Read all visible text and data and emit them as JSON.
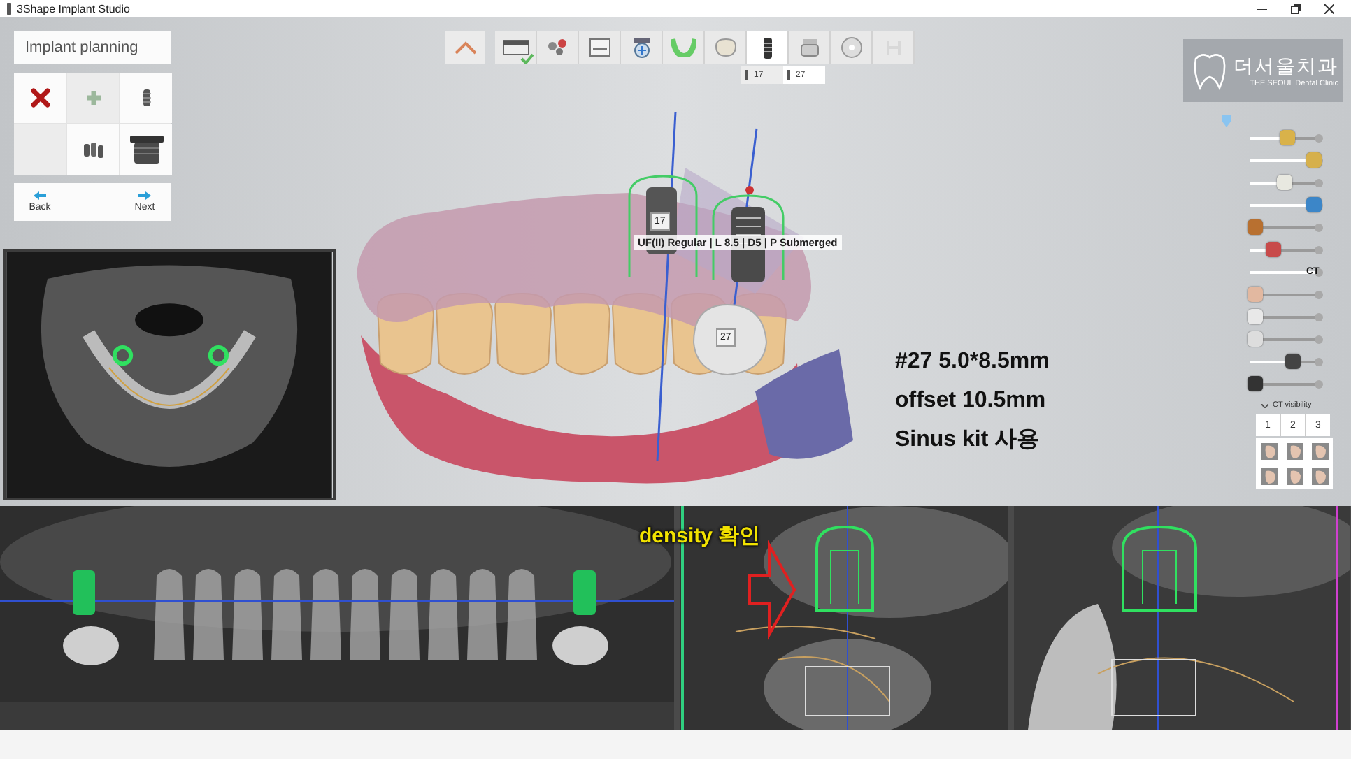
{
  "window": {
    "title": "3Shape Implant Studio"
  },
  "panel": {
    "title": "Implant planning"
  },
  "tools": [
    {
      "kind": "delete",
      "disabled": false
    },
    {
      "kind": "add",
      "disabled": true
    },
    {
      "kind": "implant",
      "disabled": false
    },
    {
      "kind": "blank",
      "disabled": true
    },
    {
      "kind": "implants",
      "disabled": false
    },
    {
      "kind": "sleeve",
      "disabled": false
    }
  ],
  "nav": [
    {
      "label": "Back",
      "kind": "back"
    },
    {
      "label": "Next",
      "kind": "next"
    }
  ],
  "workflow": {
    "steps": [
      {
        "kind": "scan",
        "selected": false,
        "done": true,
        "disabled": false
      },
      {
        "kind": "align",
        "selected": false,
        "done": false,
        "disabled": false
      },
      {
        "kind": "panel",
        "selected": false,
        "done": false,
        "disabled": false
      },
      {
        "kind": "nerve",
        "selected": false,
        "done": false,
        "disabled": false
      },
      {
        "kind": "arch",
        "selected": false,
        "done": false,
        "disabled": false
      },
      {
        "kind": "tooth",
        "selected": false,
        "done": false,
        "disabled": false
      },
      {
        "kind": "implant",
        "selected": true,
        "done": false,
        "disabled": false
      },
      {
        "kind": "sleeve",
        "selected": false,
        "done": false,
        "disabled": false
      },
      {
        "kind": "disc",
        "selected": false,
        "done": false,
        "disabled": false
      },
      {
        "kind": "guide",
        "selected": false,
        "done": false,
        "disabled": true
      }
    ],
    "implant_tabs": [
      {
        "label": "17",
        "selected": false
      },
      {
        "label": "27",
        "selected": true
      }
    ]
  },
  "logo": {
    "name": "더서울치과",
    "subtitle": "THE SEOUL Dental Clinic"
  },
  "model": {
    "implant_labels": [
      "17"
    ],
    "crown_label": "27",
    "tooltip": "UF(II) Regular | L 8.5 | D5 | P Submerged"
  },
  "annotation": {
    "lines": [
      "#27 5.0*8.5mm",
      "offset 10.5mm",
      "Sinus kit 사용"
    ]
  },
  "sliders": [
    {
      "kind": "icon",
      "level": 0.55
    },
    {
      "kind": "icon",
      "level": 1
    },
    {
      "kind": "icon",
      "level": 0.5
    },
    {
      "kind": "icon",
      "level": 1
    },
    {
      "kind": "icon",
      "level": 0
    },
    {
      "kind": "icon",
      "level": 0.3
    },
    {
      "kind": "text",
      "label": "CT",
      "level": 1
    },
    {
      "kind": "icon",
      "level": 0
    },
    {
      "kind": "icon",
      "level": 0
    },
    {
      "kind": "icon",
      "level": 0
    },
    {
      "kind": "icon",
      "level": 0.65
    },
    {
      "kind": "icon",
      "level": 0
    }
  ],
  "ct_visibility": {
    "label": "CT visibility",
    "tabs": [
      {
        "label": "1"
      },
      {
        "label": "2"
      },
      {
        "label": "3"
      }
    ]
  },
  "cross_section": {
    "note": "density 확인"
  }
}
